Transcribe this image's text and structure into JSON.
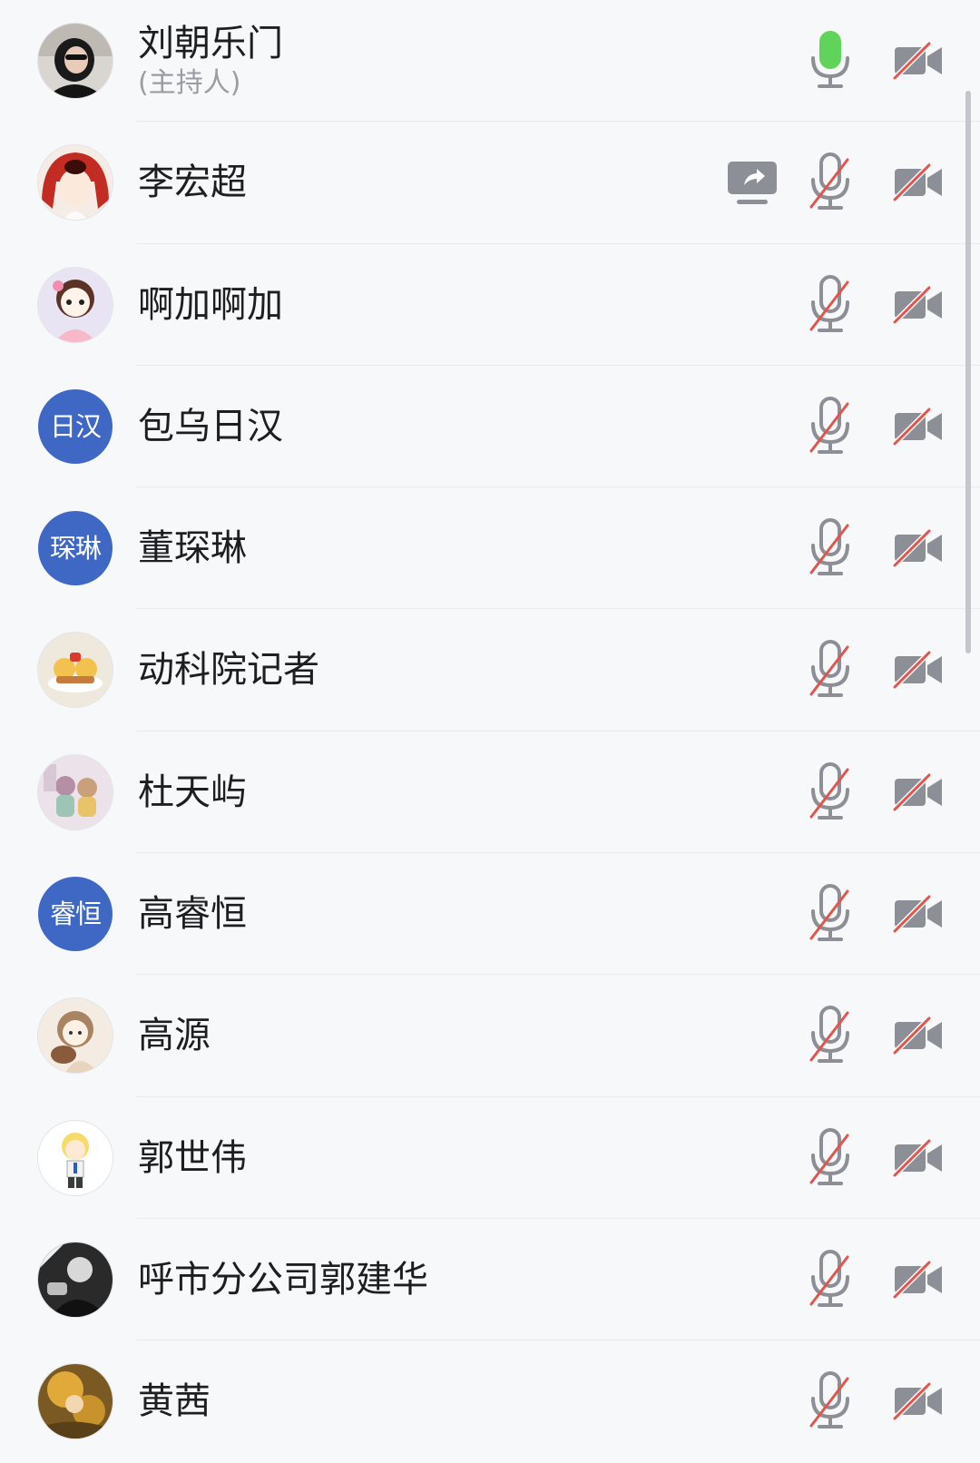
{
  "participants": [
    {
      "name": "刘朝乐门",
      "role": "(主持人)",
      "avatar": {
        "kind": "photo",
        "style": "dark-portrait"
      },
      "sharing": false,
      "mic": "on",
      "camera": "off"
    },
    {
      "name": "李宏超",
      "avatar": {
        "kind": "photo",
        "style": "red-hair-cartoon"
      },
      "sharing": true,
      "mic": "off",
      "camera": "off"
    },
    {
      "name": "啊加啊加",
      "avatar": {
        "kind": "photo",
        "style": "pink-cartoon-girl"
      },
      "sharing": false,
      "mic": "off",
      "camera": "off"
    },
    {
      "name": "包乌日汉",
      "avatar": {
        "kind": "initials",
        "text": "日汉"
      },
      "sharing": false,
      "mic": "off",
      "camera": "off"
    },
    {
      "name": "董琛琳",
      "avatar": {
        "kind": "initials",
        "text": "琛琳"
      },
      "sharing": false,
      "mic": "off",
      "camera": "off"
    },
    {
      "name": "动科院记者",
      "avatar": {
        "kind": "photo",
        "style": "yellow-bears"
      },
      "sharing": false,
      "mic": "off",
      "camera": "off"
    },
    {
      "name": "杜天屿",
      "avatar": {
        "kind": "photo",
        "style": "pastel-girls"
      },
      "sharing": false,
      "mic": "off",
      "camera": "off"
    },
    {
      "name": "高睿恒",
      "avatar": {
        "kind": "initials",
        "text": "睿恒"
      },
      "sharing": false,
      "mic": "off",
      "camera": "off"
    },
    {
      "name": "高源",
      "avatar": {
        "kind": "photo",
        "style": "beige-cartoon-girl"
      },
      "sharing": false,
      "mic": "off",
      "camera": "off"
    },
    {
      "name": "郭世伟",
      "avatar": {
        "kind": "photo",
        "style": "blonde-cartoon-boy"
      },
      "sharing": false,
      "mic": "off",
      "camera": "off"
    },
    {
      "name": "呼市分公司郭建华",
      "avatar": {
        "kind": "photo",
        "style": "black-white-photo"
      },
      "sharing": false,
      "mic": "off",
      "camera": "off"
    },
    {
      "name": "黄茜",
      "avatar": {
        "kind": "photo",
        "style": "golden-painting"
      },
      "sharing": false,
      "mic": "off",
      "camera": "off"
    }
  ],
  "colors": {
    "mic_on": "#5fd35a",
    "icon_gray": "#8c8f96",
    "slash_red": "#e2554f",
    "initials_bg": "#3f67c4"
  },
  "icons": {
    "share": "screen-share-icon",
    "mic_on": "microphone-icon",
    "mic_off": "microphone-muted-icon",
    "camera_off": "camera-off-icon"
  }
}
